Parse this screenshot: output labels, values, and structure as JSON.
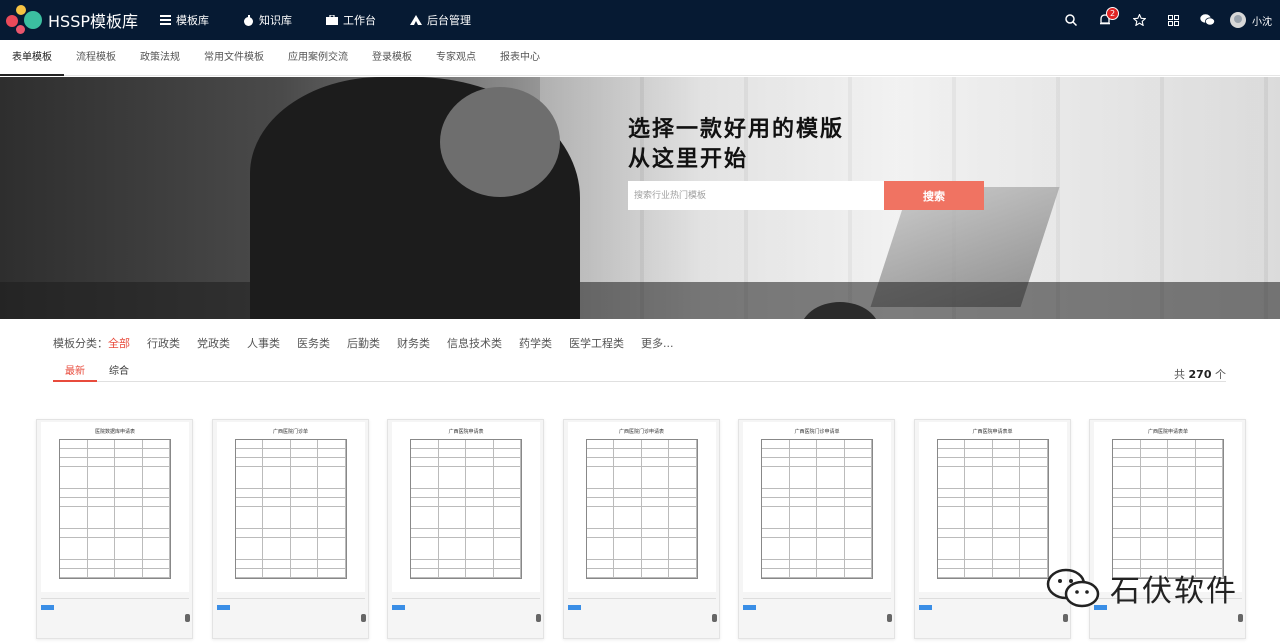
{
  "brand": {
    "name": "HSSP模板库"
  },
  "topnav": [
    {
      "label": "模板库",
      "icon": "list-icon"
    },
    {
      "label": "知识库",
      "icon": "apple-icon"
    },
    {
      "label": "工作台",
      "icon": "briefcase-icon"
    },
    {
      "label": "后台管理",
      "icon": "settings-icon"
    }
  ],
  "topright": {
    "notification_count": "2",
    "username": "小沈"
  },
  "subtabs": [
    "表单模板",
    "流程模板",
    "政策法规",
    "常用文件模板",
    "应用案例交流",
    "登录模板",
    "专家观点",
    "报表中心"
  ],
  "hero": {
    "line1": "选择一款好用的模版",
    "line2": "从这里开始",
    "search_placeholder": "搜索行业热门模板",
    "search_button": "搜索"
  },
  "categories": {
    "label": "模板分类：",
    "selected": "全部",
    "items": [
      "行政类",
      "党政类",
      "人事类",
      "医务类",
      "后勤类",
      "财务类",
      "信息技术类",
      "药学类",
      "医学工程类",
      "更多..."
    ]
  },
  "sort": {
    "tabs": [
      "最新",
      "综合"
    ],
    "total_prefix": "共",
    "total_count": "270",
    "total_suffix": "个"
  },
  "cards": [
    {
      "title": "医院数据库申请表"
    },
    {
      "title": "广西医院门诊单"
    },
    {
      "title": "广西医院申请表"
    },
    {
      "title": "广西医院门诊申请表"
    },
    {
      "title": "广西医院门诊申请单"
    },
    {
      "title": "广西医院申请表单"
    },
    {
      "title": "广西医院申请表单"
    }
  ],
  "watermark": {
    "text": "石伏软件"
  }
}
